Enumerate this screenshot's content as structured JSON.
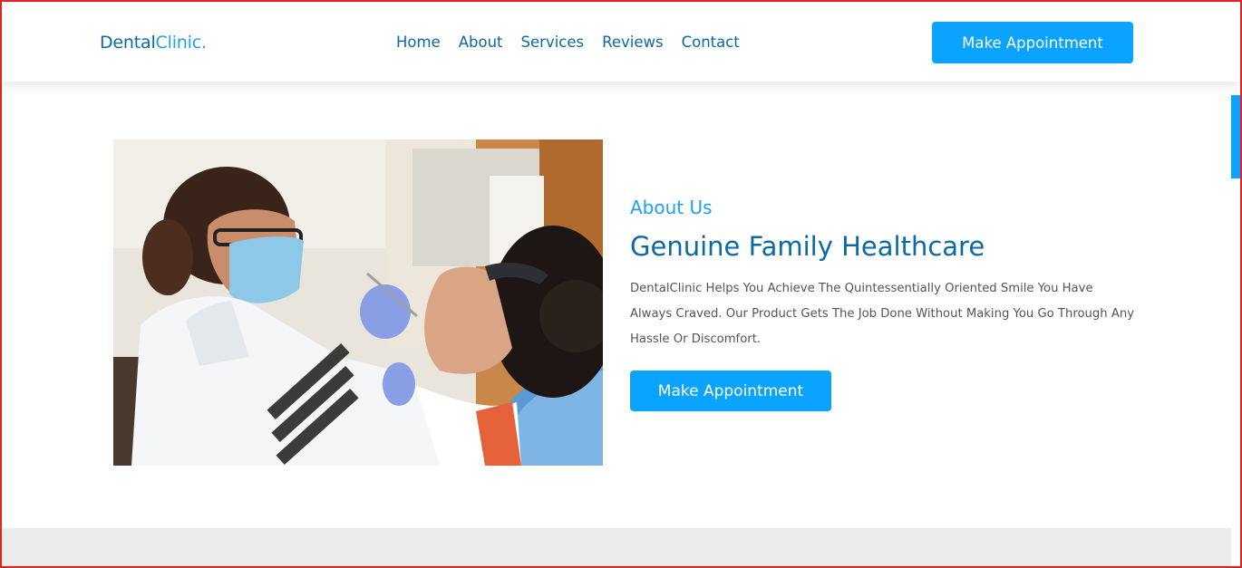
{
  "header": {
    "logo_dark": "Dental",
    "logo_light": "Clinic.",
    "nav": [
      "Home",
      "About",
      "Services",
      "Reviews",
      "Contact"
    ],
    "cta": "Make Appointment"
  },
  "about": {
    "kicker": "About Us",
    "title": "Genuine Family Healthcare",
    "body": "DentalClinic Helps You Achieve The Quintessentially Oriented Smile You Have Always Craved. Our Product Gets The Job Done Without Making You Go Through Any Hassle Or Discomfort.",
    "cta": "Make Appointment"
  },
  "colors": {
    "brand_dark": "#0b6aa4",
    "brand_light": "#1da1f2",
    "button": "#0aa3ff"
  }
}
